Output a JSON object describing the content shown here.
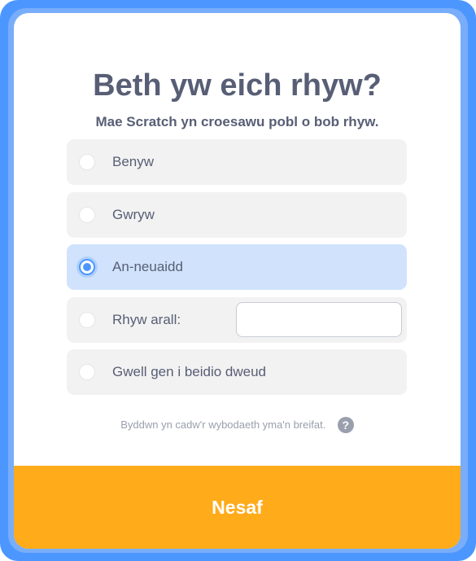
{
  "dialog": {
    "title": "Beth yw eich rhyw?",
    "subtitle": "Mae Scratch yn croesawu pobl o bob rhyw."
  },
  "options": [
    {
      "label": "Benyw",
      "selected": false
    },
    {
      "label": "Gwryw",
      "selected": false
    },
    {
      "label": "An-neuaidd",
      "selected": true
    },
    {
      "label": "Rhyw arall:",
      "selected": false,
      "input_value": "",
      "input_placeholder": ""
    },
    {
      "label": "Gwell gen i beidio dweud",
      "selected": false
    }
  ],
  "privacy": {
    "text": "Byddwn yn cadw'r wybodaeth yma'n breifat.",
    "help_icon": "question-mark-icon",
    "help_glyph": "?"
  },
  "next_button": {
    "label": "Nesaf"
  },
  "colors": {
    "frame": "#4c97ff",
    "text": "#575e75",
    "option_bg": "#f2f2f2",
    "option_selected_bg": "#d1e3fc",
    "radio_selected": "#4c97ff",
    "next_button_bg": "#ffab1a",
    "muted_text": "#9a9fad"
  }
}
